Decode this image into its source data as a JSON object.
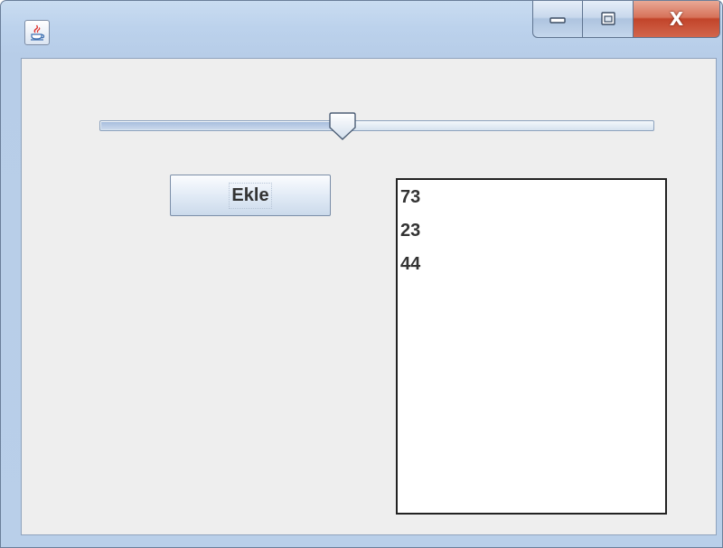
{
  "window": {
    "title": "",
    "controls": {
      "minimize_icon": "minimize-icon",
      "maximize_icon": "maximize-icon",
      "close_label": "X"
    },
    "app_icon": "java-cup-icon"
  },
  "slider": {
    "value": 0.44
  },
  "add_button": {
    "label": "Ekle"
  },
  "number_list": {
    "items": [
      "73",
      "23",
      "44"
    ]
  },
  "colors": {
    "titlebar": "#bcd2ec",
    "client_background": "#eeeeee",
    "close_button": "#c2442a",
    "list_border": "#222222"
  }
}
